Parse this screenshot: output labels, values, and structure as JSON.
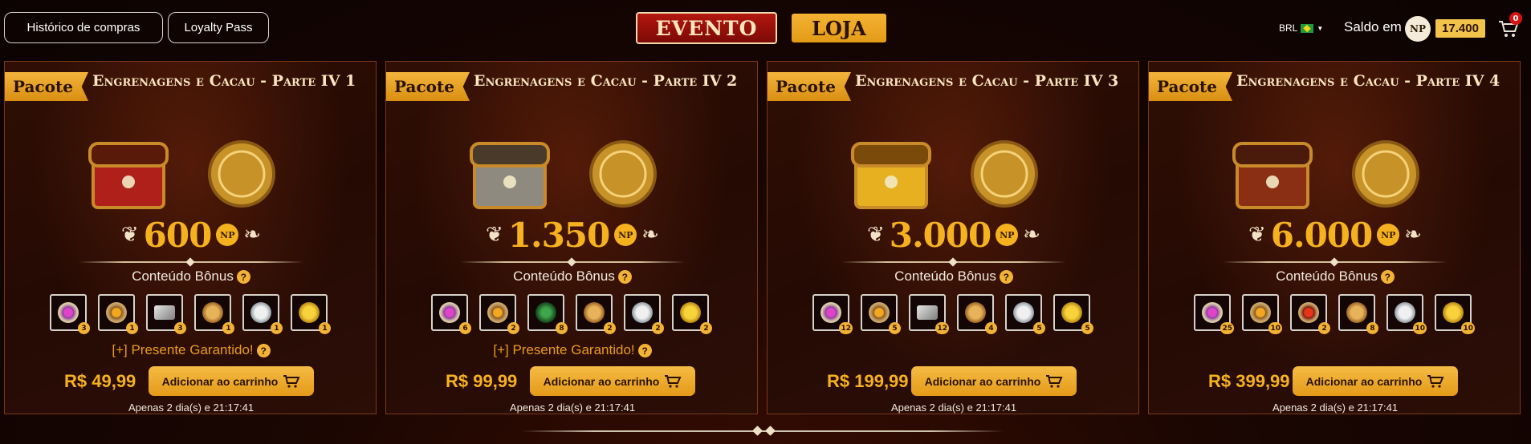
{
  "topbar": {
    "history_label": "Histórico de compras",
    "loyalty_label": "Loyalty Pass",
    "tab_event": "EVENTO",
    "tab_store": "LOJA",
    "currency": "BRL",
    "balance_label": "Saldo em",
    "balance_coin": "NP",
    "balance_value": "17.400",
    "cart_count": "0"
  },
  "colors": {
    "accent": "#f6b21e",
    "event_tab": "#b3170f",
    "gift_text": "#e99c16"
  },
  "cards": [
    {
      "tag": "Pacote",
      "title": "Engrenagens e Cacau - Parte IV 1",
      "np_amount": "600",
      "np_label": "NP",
      "bonus_label": "Conteúdo Bônus",
      "items": [
        {
          "icon": "pink-gem-coin",
          "count": "3"
        },
        {
          "icon": "gold-gem-coin",
          "count": "1"
        },
        {
          "icon": "silver-ingot",
          "count": "3"
        },
        {
          "icon": "bronze-coin",
          "count": "1"
        },
        {
          "icon": "silver-coin",
          "count": "1"
        },
        {
          "icon": "medal",
          "count": "1"
        }
      ],
      "gift": "[+] Presente Garantido!",
      "price": "R$ 49,99",
      "button": "Adicionar ao carrinho",
      "timer": "Apenas 2 dia(s) e 21:17:41"
    },
    {
      "tag": "Pacote",
      "title": "Engrenagens e Cacau - Parte IV 2",
      "np_amount": "1.350",
      "np_label": "NP",
      "bonus_label": "Conteúdo Bônus",
      "items": [
        {
          "icon": "pink-gem-coin",
          "count": "6"
        },
        {
          "icon": "gold-gem-coin",
          "count": "2"
        },
        {
          "icon": "green-drop",
          "count": "8"
        },
        {
          "icon": "bronze-coin",
          "count": "2"
        },
        {
          "icon": "silver-coin",
          "count": "2"
        },
        {
          "icon": "medal",
          "count": "2"
        }
      ],
      "gift": "[+] Presente Garantido!",
      "price": "R$ 99,99",
      "button": "Adicionar ao carrinho",
      "timer": "Apenas 2 dia(s) e 21:17:41"
    },
    {
      "tag": "Pacote",
      "title": "Engrenagens e Cacau - Parte IV 3",
      "np_amount": "3.000",
      "np_label": "NP",
      "bonus_label": "Conteúdo Bônus",
      "items": [
        {
          "icon": "pink-gem-coin",
          "count": "12"
        },
        {
          "icon": "gold-gem-coin",
          "count": "5"
        },
        {
          "icon": "silver-ingot",
          "count": "12"
        },
        {
          "icon": "bronze-coin",
          "count": "4"
        },
        {
          "icon": "silver-coin",
          "count": "5"
        },
        {
          "icon": "medal",
          "count": "5"
        }
      ],
      "gift": "",
      "price": "R$ 199,99",
      "button": "Adicionar ao carrinho",
      "timer": "Apenas 2 dia(s) e 21:17:41"
    },
    {
      "tag": "Pacote",
      "title": "Engrenagens e Cacau - Parte IV 4",
      "np_amount": "6.000",
      "np_label": "NP",
      "bonus_label": "Conteúdo Bônus",
      "items": [
        {
          "icon": "pink-gem-coin",
          "count": "25"
        },
        {
          "icon": "gold-gem-coin",
          "count": "10"
        },
        {
          "icon": "red-gem-coin",
          "count": "2"
        },
        {
          "icon": "bronze-coin",
          "count": "8"
        },
        {
          "icon": "silver-coin",
          "count": "10"
        },
        {
          "icon": "medal",
          "count": "10"
        }
      ],
      "gift": "",
      "price": "R$ 399,99",
      "button": "Adicionar ao carrinho",
      "timer": "Apenas 2 dia(s) e 21:17:41"
    }
  ]
}
